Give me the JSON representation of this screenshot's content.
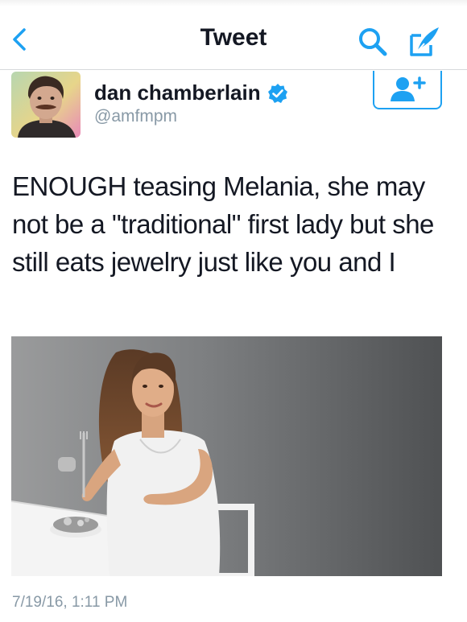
{
  "header": {
    "title": "Tweet",
    "back_icon": "chevron-left-icon",
    "search_icon": "search-icon",
    "compose_icon": "compose-icon"
  },
  "author": {
    "name": "dan chamberlain",
    "handle": "@amfmpm",
    "verified": true,
    "avatar": "avatar-photo",
    "follow_icon": "add-user-icon"
  },
  "tweet": {
    "text": "ENOUGH teasing Melania, she may not be a \"traditional\" first lady but she still eats jewelry just like you and I",
    "photo": "tweet-photo",
    "timestamp": "7/19/16, 1:11 PM"
  },
  "colors": {
    "accent": "#1da1f2",
    "text": "#141823",
    "secondary_text": "#8899a6",
    "divider": "#d6d9dc"
  }
}
